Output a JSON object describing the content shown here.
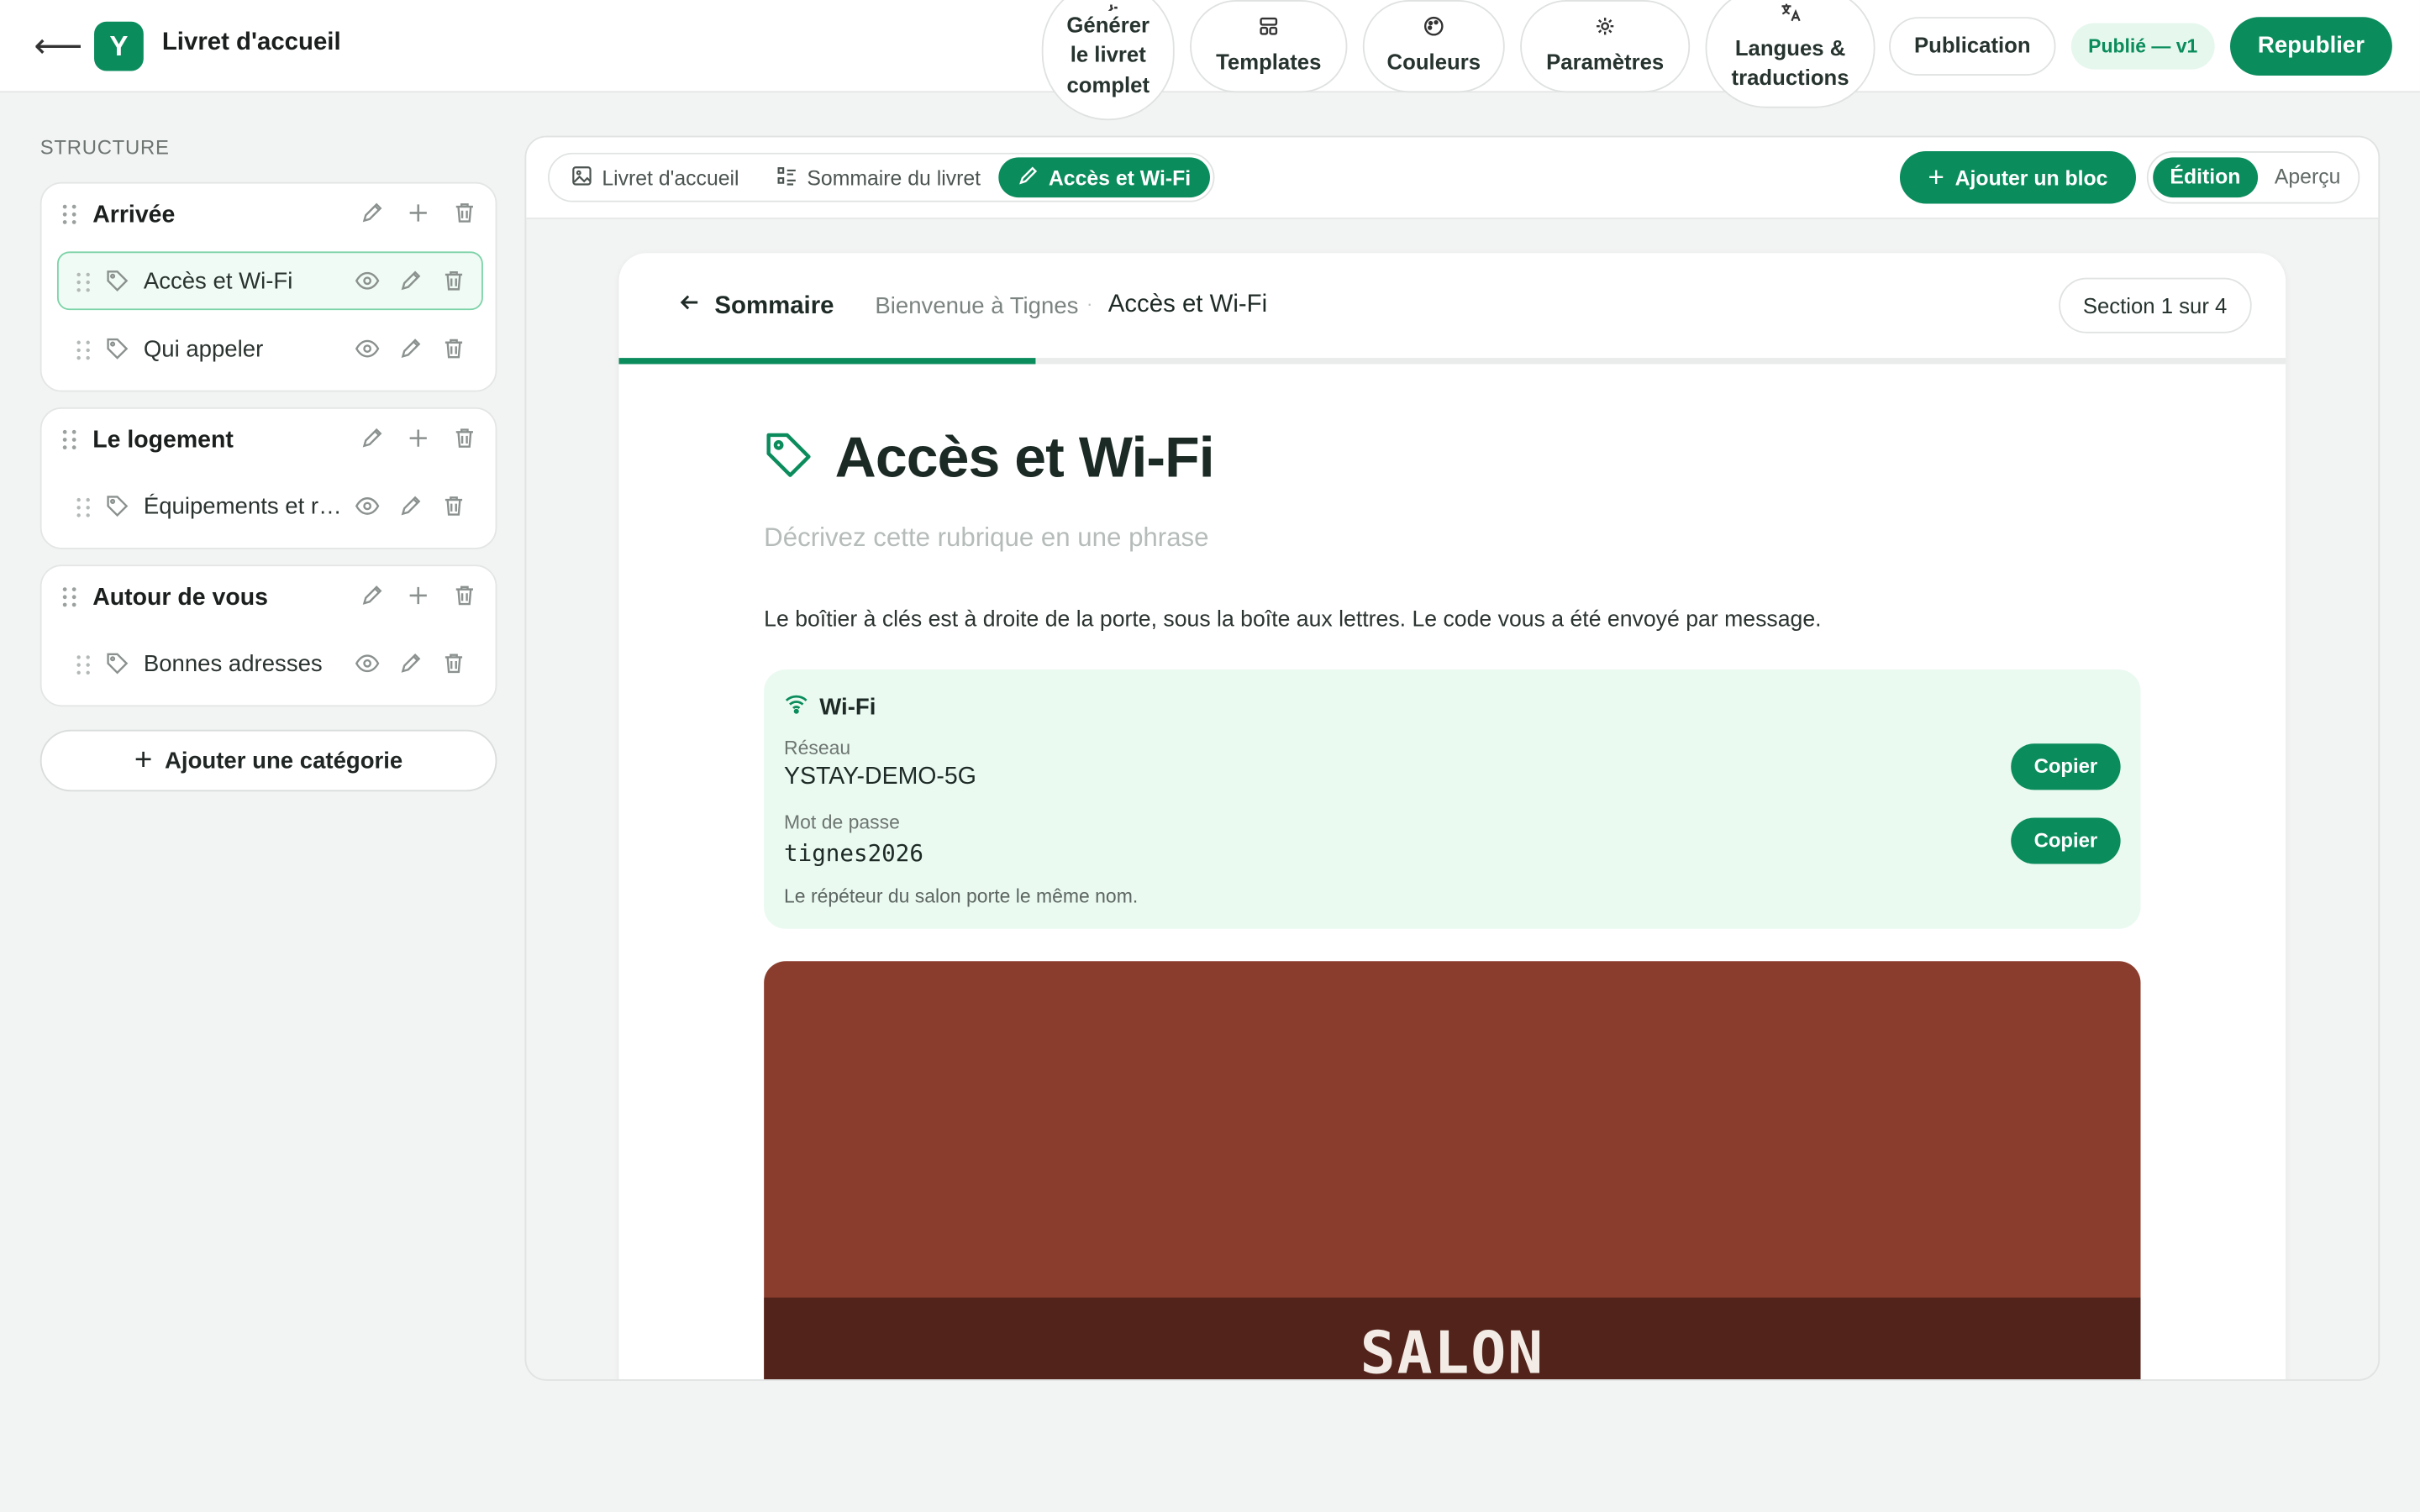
{
  "app": {
    "title": "Livret d'accueil",
    "logo_letter": "Y"
  },
  "topbar": {
    "generate_label": "Générer le livret complet",
    "templates_label": "Templates",
    "colors_label": "Couleurs",
    "settings_label": "Paramètres",
    "languages_label": "Langues & traductions",
    "publication_label": "Publication",
    "status_badge": "Publié — v1",
    "republish_label": "Republier"
  },
  "sidebar": {
    "structure_label": "STRUCTURE",
    "categories": [
      {
        "name": "Arrivée",
        "items": [
          {
            "label": "Accès et Wi-Fi",
            "selected": true
          },
          {
            "label": "Qui appeler",
            "selected": false
          }
        ]
      },
      {
        "name": "Le logement",
        "items": [
          {
            "label": "Équipements et r…",
            "selected": false
          }
        ]
      },
      {
        "name": "Autour de vous",
        "items": [
          {
            "label": "Bonnes adresses",
            "selected": false
          }
        ]
      }
    ],
    "add_category_label": "Ajouter une catégorie"
  },
  "main": {
    "tabs": [
      {
        "label": "Livret d'accueil",
        "icon": "image-icon"
      },
      {
        "label": "Sommaire du livret",
        "icon": "list-icon"
      },
      {
        "label": "Accès et Wi-Fi",
        "icon": "pencil-icon",
        "active": true
      }
    ],
    "add_block_label": "Ajouter un bloc",
    "mode_edit": "Édition",
    "mode_preview": "Aperçu"
  },
  "preview": {
    "back_label": "Sommaire",
    "breadcrumb_parent": "Bienvenue à Tignes",
    "breadcrumb_current": "Accès et Wi-Fi",
    "section_badge": "Section 1 sur 4",
    "progress": 0.25,
    "title": "Accès et Wi-Fi",
    "subtitle_placeholder": "Décrivez cette rubrique en une phrase",
    "body": "Le boîtier à clés est à droite de la porte, sous la boîte aux lettres. Le code vous a été envoyé par message.",
    "wifi": {
      "heading": "Wi-Fi",
      "network_label": "Réseau",
      "network_value": "YSTAY-DEMO-5G",
      "password_label": "Mot de passe",
      "password_value": "tignes2026",
      "copy_label": "Copier",
      "note": "Le répéteur du salon porte le même nom."
    },
    "image_caption": "SALON"
  },
  "colors": {
    "accent": "#0b8c5d",
    "image_bg": "#8b3d2d",
    "image_strip": "#52231a"
  }
}
